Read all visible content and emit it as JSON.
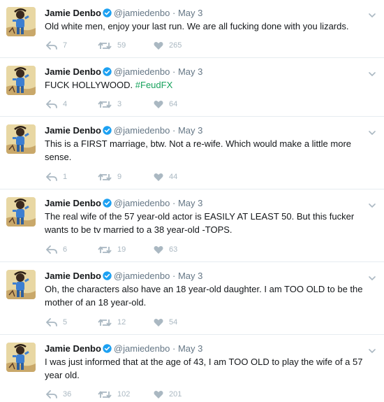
{
  "user": {
    "name": "Jamie Denbo",
    "handle": "@jamiedenbo",
    "separator": "·",
    "date": "May 3"
  },
  "colors": {
    "hashtag": "#17a25c",
    "verified": "#1da1f2",
    "action": "#aab8c2"
  },
  "icons": {
    "reply": "reply-icon",
    "retweet": "retweet-icon",
    "like": "heart-icon",
    "caret": "chevron-down-icon"
  },
  "tweets": [
    {
      "text": "Old white men, enjoy your last run. We are all fucking done with you lizards.",
      "hashtag": "",
      "replies": "7",
      "retweets": "59",
      "likes": "265"
    },
    {
      "text": "FUCK HOLLYWOOD. ",
      "hashtag": "#FeudFX",
      "replies": "4",
      "retweets": "3",
      "likes": "64"
    },
    {
      "text": "This is a FIRST marriage, btw.  Not a re-wife.  Which would make a little more sense.",
      "hashtag": "",
      "replies": "1",
      "retweets": "9",
      "likes": "44"
    },
    {
      "text": "The real wife of the 57 year-old actor is EASILY AT LEAST 50. But this fucker wants to be tv married to a 38 year-old -TOPS.",
      "hashtag": "",
      "replies": "6",
      "retweets": "19",
      "likes": "63"
    },
    {
      "text": "Oh, the characters also have an 18 year-old daughter.  I am TOO OLD to be the mother of an 18 year-old.",
      "hashtag": "",
      "replies": "5",
      "retweets": "12",
      "likes": "54"
    },
    {
      "text": "I was just informed that at the age of 43, I am TOO OLD to play the wife of a 57 year old.",
      "hashtag": "",
      "replies": "36",
      "retweets": "102",
      "likes": "201"
    }
  ]
}
